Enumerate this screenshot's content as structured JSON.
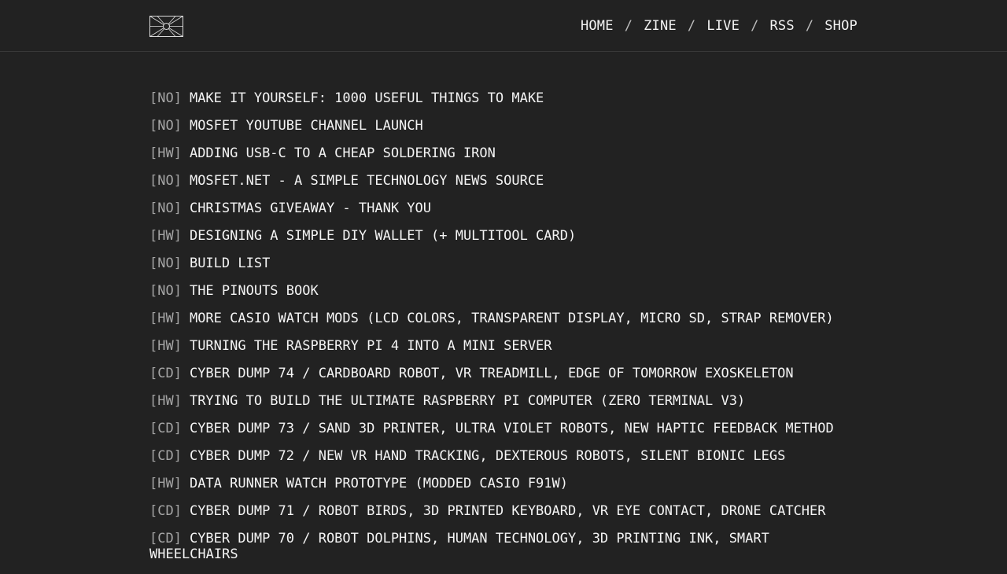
{
  "header": {
    "logo_icon": "sun-rays-logo-icon",
    "nav": [
      {
        "label": "HOME"
      },
      {
        "label": "ZINE"
      },
      {
        "label": "LIVE"
      },
      {
        "label": "RSS"
      },
      {
        "label": "SHOP"
      }
    ],
    "separator": "/"
  },
  "posts": [
    {
      "tag": "[NO]",
      "title": "MAKE IT YOURSELF: 1000 USEFUL THINGS TO MAKE"
    },
    {
      "tag": "[NO]",
      "title": "MOSFET YOUTUBE CHANNEL LAUNCH"
    },
    {
      "tag": "[HW]",
      "title": "ADDING USB-C TO A CHEAP SOLDERING IRON"
    },
    {
      "tag": "[NO]",
      "title": "MOSFET.NET - A SIMPLE TECHNOLOGY NEWS SOURCE"
    },
    {
      "tag": "[NO]",
      "title": "CHRISTMAS GIVEAWAY - THANK YOU"
    },
    {
      "tag": "[HW]",
      "title": "DESIGNING A SIMPLE DIY WALLET (+ MULTITOOL CARD)"
    },
    {
      "tag": "[NO]",
      "title": "BUILD LIST"
    },
    {
      "tag": "[NO]",
      "title": "THE PINOUTS BOOK"
    },
    {
      "tag": "[HW]",
      "title": "MORE CASIO WATCH MODS (LCD COLORS, TRANSPARENT DISPLAY, MICRO SD, STRAP REMOVER)"
    },
    {
      "tag": "[HW]",
      "title": "TURNING THE RASPBERRY PI 4 INTO A MINI SERVER"
    },
    {
      "tag": "[CD]",
      "title": "CYBER DUMP 74 / CARDBOARD ROBOT, VR TREADMILL, EDGE OF TOMORROW EXOSKELETON"
    },
    {
      "tag": "[HW]",
      "title": "TRYING TO BUILD THE ULTIMATE RASPBERRY PI COMPUTER (ZERO TERMINAL V3)"
    },
    {
      "tag": "[CD]",
      "title": "CYBER DUMP 73 / SAND 3D PRINTER, ULTRA VIOLET ROBOTS, NEW HAPTIC FEEDBACK METHOD"
    },
    {
      "tag": "[CD]",
      "title": "CYBER DUMP 72 / NEW VR HAND TRACKING, DEXTEROUS ROBOTS, SILENT BIONIC LEGS"
    },
    {
      "tag": "[HW]",
      "title": "DATA RUNNER WATCH PROTOTYPE (MODDED CASIO F91W)"
    },
    {
      "tag": "[CD]",
      "title": "CYBER DUMP 71 / ROBOT BIRDS, 3D PRINTED KEYBOARD, VR EYE CONTACT, DRONE CATCHER"
    },
    {
      "tag": "[CD]",
      "title": "CYBER DUMP 70 / ROBOT DOLPHINS, HUMAN TECHNOLOGY, 3D PRINTING INK, SMART WHEELCHAIRS"
    }
  ]
}
